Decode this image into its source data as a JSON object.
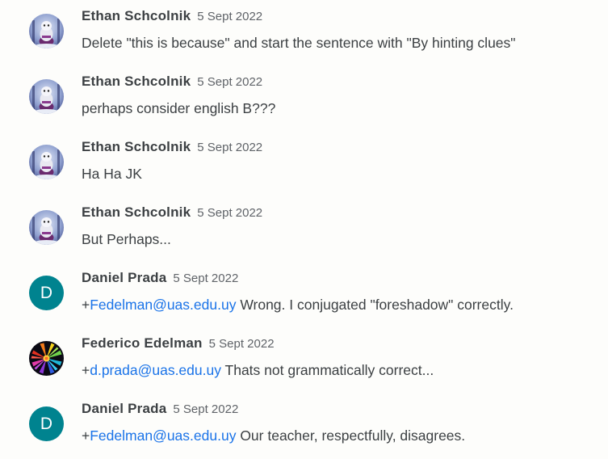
{
  "comments": [
    {
      "author": "Ethan Schcolnik",
      "date": "5 Sept 2022",
      "avatar": "photo",
      "prefix": "",
      "mention": "",
      "text": "Delete \"this is because\" and start the sentence with \"By hinting clues\""
    },
    {
      "author": "Ethan Schcolnik",
      "date": "5 Sept 2022",
      "avatar": "photo",
      "prefix": "",
      "mention": "",
      "text": "perhaps consider english B???"
    },
    {
      "author": "Ethan Schcolnik",
      "date": "5 Sept 2022",
      "avatar": "photo",
      "prefix": "",
      "mention": "",
      "text": "Ha Ha JK"
    },
    {
      "author": "Ethan Schcolnik",
      "date": "5 Sept 2022",
      "avatar": "photo",
      "prefix": "",
      "mention": "",
      "text": "But Perhaps..."
    },
    {
      "author": "Daniel Prada",
      "date": "5 Sept 2022",
      "avatar": "letter",
      "avatar_letter": "D",
      "prefix": "+",
      "mention": "Fedelman@uas.edu.uy",
      "text": " Wrong. I conjugated \"foreshadow\" correctly."
    },
    {
      "author": "Federico Edelman",
      "date": "5 Sept 2022",
      "avatar": "photo-colorful",
      "prefix": "+",
      "mention": "d.prada@uas.edu.uy",
      "text": " Thats not grammatically correct..."
    },
    {
      "author": "Daniel Prada",
      "date": "5 Sept 2022",
      "avatar": "letter",
      "avatar_letter": "D",
      "prefix": "+",
      "mention": "Fedelman@uas.edu.uy",
      "text": " Our teacher, respectfully, disagrees."
    }
  ],
  "colors": {
    "letter_avatar_bg": "#00838f",
    "mention": "#1a73e8",
    "text": "#3c4043",
    "date": "#5f6368"
  }
}
